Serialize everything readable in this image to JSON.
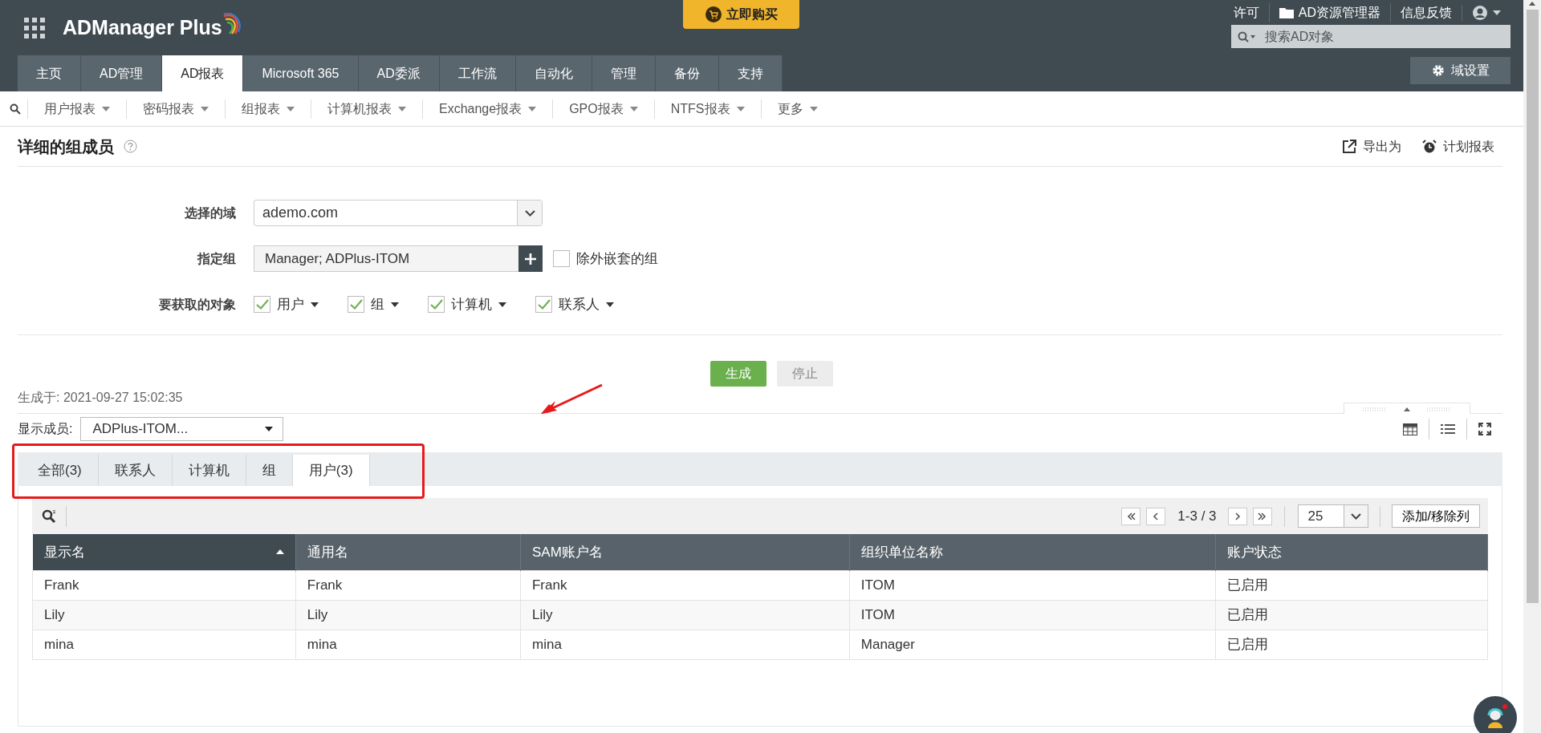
{
  "header": {
    "logo": "ADManager Plus",
    "buy_button": "立即购买",
    "top_links": [
      {
        "label": "许可",
        "kind": "text"
      },
      {
        "label": "AD资源管理器",
        "kind": "folder"
      },
      {
        "label": "信息反馈",
        "kind": "text"
      }
    ],
    "search": {
      "placeholder": "搜索AD对象"
    }
  },
  "main_tabs": [
    {
      "label": "主页",
      "selected": false
    },
    {
      "label": "AD管理",
      "selected": false
    },
    {
      "label": "AD报表",
      "selected": true
    },
    {
      "label": "Microsoft 365",
      "selected": false
    },
    {
      "label": "AD委派",
      "selected": false
    },
    {
      "label": "工作流",
      "selected": false
    },
    {
      "label": "自动化",
      "selected": false
    },
    {
      "label": "管理",
      "selected": false
    },
    {
      "label": "备份",
      "selected": false
    },
    {
      "label": "支持",
      "selected": false
    }
  ],
  "domain_settings": "域设置",
  "sub_menu": [
    "用户报表",
    "密码报表",
    "组报表",
    "计算机报表",
    "Exchange报表",
    "GPO报表",
    "NTFS报表",
    "更多"
  ],
  "report": {
    "title": "详细的组成员",
    "actions": [
      {
        "label": "导出为",
        "kind": "export"
      },
      {
        "label": "计划报表",
        "kind": "schedule"
      }
    ]
  },
  "form": {
    "domain": {
      "label": "选择的域",
      "value": "ademo.com"
    },
    "group": {
      "label": "指定组",
      "value": "Manager; ADPlus-ITOM",
      "exclude_nested": {
        "label": "除外嵌套的组",
        "checked": false
      }
    },
    "objects": {
      "label": "要获取的对象",
      "items": [
        {
          "label": "用户",
          "checked": true
        },
        {
          "label": "组",
          "checked": true
        },
        {
          "label": "计算机",
          "checked": true
        },
        {
          "label": "联系人",
          "checked": true
        }
      ]
    }
  },
  "buttons": [
    {
      "label": "生成",
      "disabled": false
    },
    {
      "label": "停止",
      "disabled": true
    }
  ],
  "generated_at": "生成于: 2021-09-27 15:02:35",
  "member_select": {
    "label": "显示成员:",
    "value": "ADPlus-ITOM..."
  },
  "result_tabs": [
    {
      "label": "全部(3)",
      "selected": false
    },
    {
      "label": "联系人",
      "selected": false
    },
    {
      "label": "计算机",
      "selected": false
    },
    {
      "label": "组",
      "selected": false
    },
    {
      "label": "用户(3)",
      "selected": true
    }
  ],
  "pager": {
    "range": "1-3 / 3",
    "page_size": "25",
    "columns_button": "添加/移除列"
  },
  "table": {
    "columns": [
      {
        "label": "显示名",
        "sorted": true
      },
      {
        "label": "通用名",
        "sorted": false
      },
      {
        "label": "SAM账户名",
        "sorted": false
      },
      {
        "label": "组织单位名称",
        "sorted": false
      },
      {
        "label": "账户状态",
        "sorted": false
      }
    ],
    "rows": [
      [
        "Frank",
        "Frank",
        "Frank",
        "ITOM",
        "已启用"
      ],
      [
        "Lily",
        "Lily",
        "Lily",
        "ITOM",
        "已启用"
      ],
      [
        "mina",
        "mina",
        "mina",
        "Manager",
        "已启用"
      ]
    ]
  }
}
